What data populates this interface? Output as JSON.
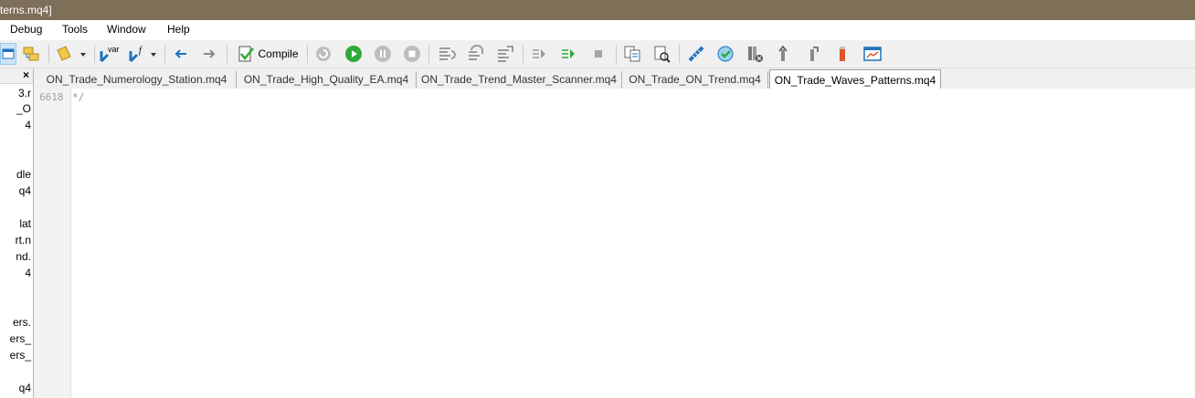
{
  "window": {
    "title": "terns.mq4]"
  },
  "menu": {
    "items": [
      "Debug",
      "Tools",
      "Window",
      "Help"
    ]
  },
  "toolbar": {
    "compile_label": "Compile",
    "var_label": "var",
    "f_label": "f"
  },
  "left_panel": {
    "close_symbol": "×",
    "fragments": [
      "3.r",
      "_O",
      "4",
      "dle",
      "q4",
      "lat",
      "rt.n",
      "nd.",
      "4",
      "ers.",
      "ers_",
      "ers_",
      "q4"
    ]
  },
  "tabs": [
    {
      "label": "ON_Trade_Numerology_Station.mq4",
      "active": false
    },
    {
      "label": "ON_Trade_High_Quality_EA.mq4",
      "active": false
    },
    {
      "label": "ON_Trade_Trend_Master_Scanner.mq4",
      "active": false
    },
    {
      "label": "ON_Trade_ON_Trend.mq4",
      "active": false
    },
    {
      "label": "ON_Trade_Waves_Patterns.mq4",
      "active": true
    }
  ],
  "editor": {
    "line_number": "6618",
    "line_text": "*/"
  },
  "colors": {
    "titlebar": "#7d6f58",
    "accent_blue": "#1e73be",
    "run_green": "#2faa3a",
    "bookmark_orange": "#e0552b"
  }
}
